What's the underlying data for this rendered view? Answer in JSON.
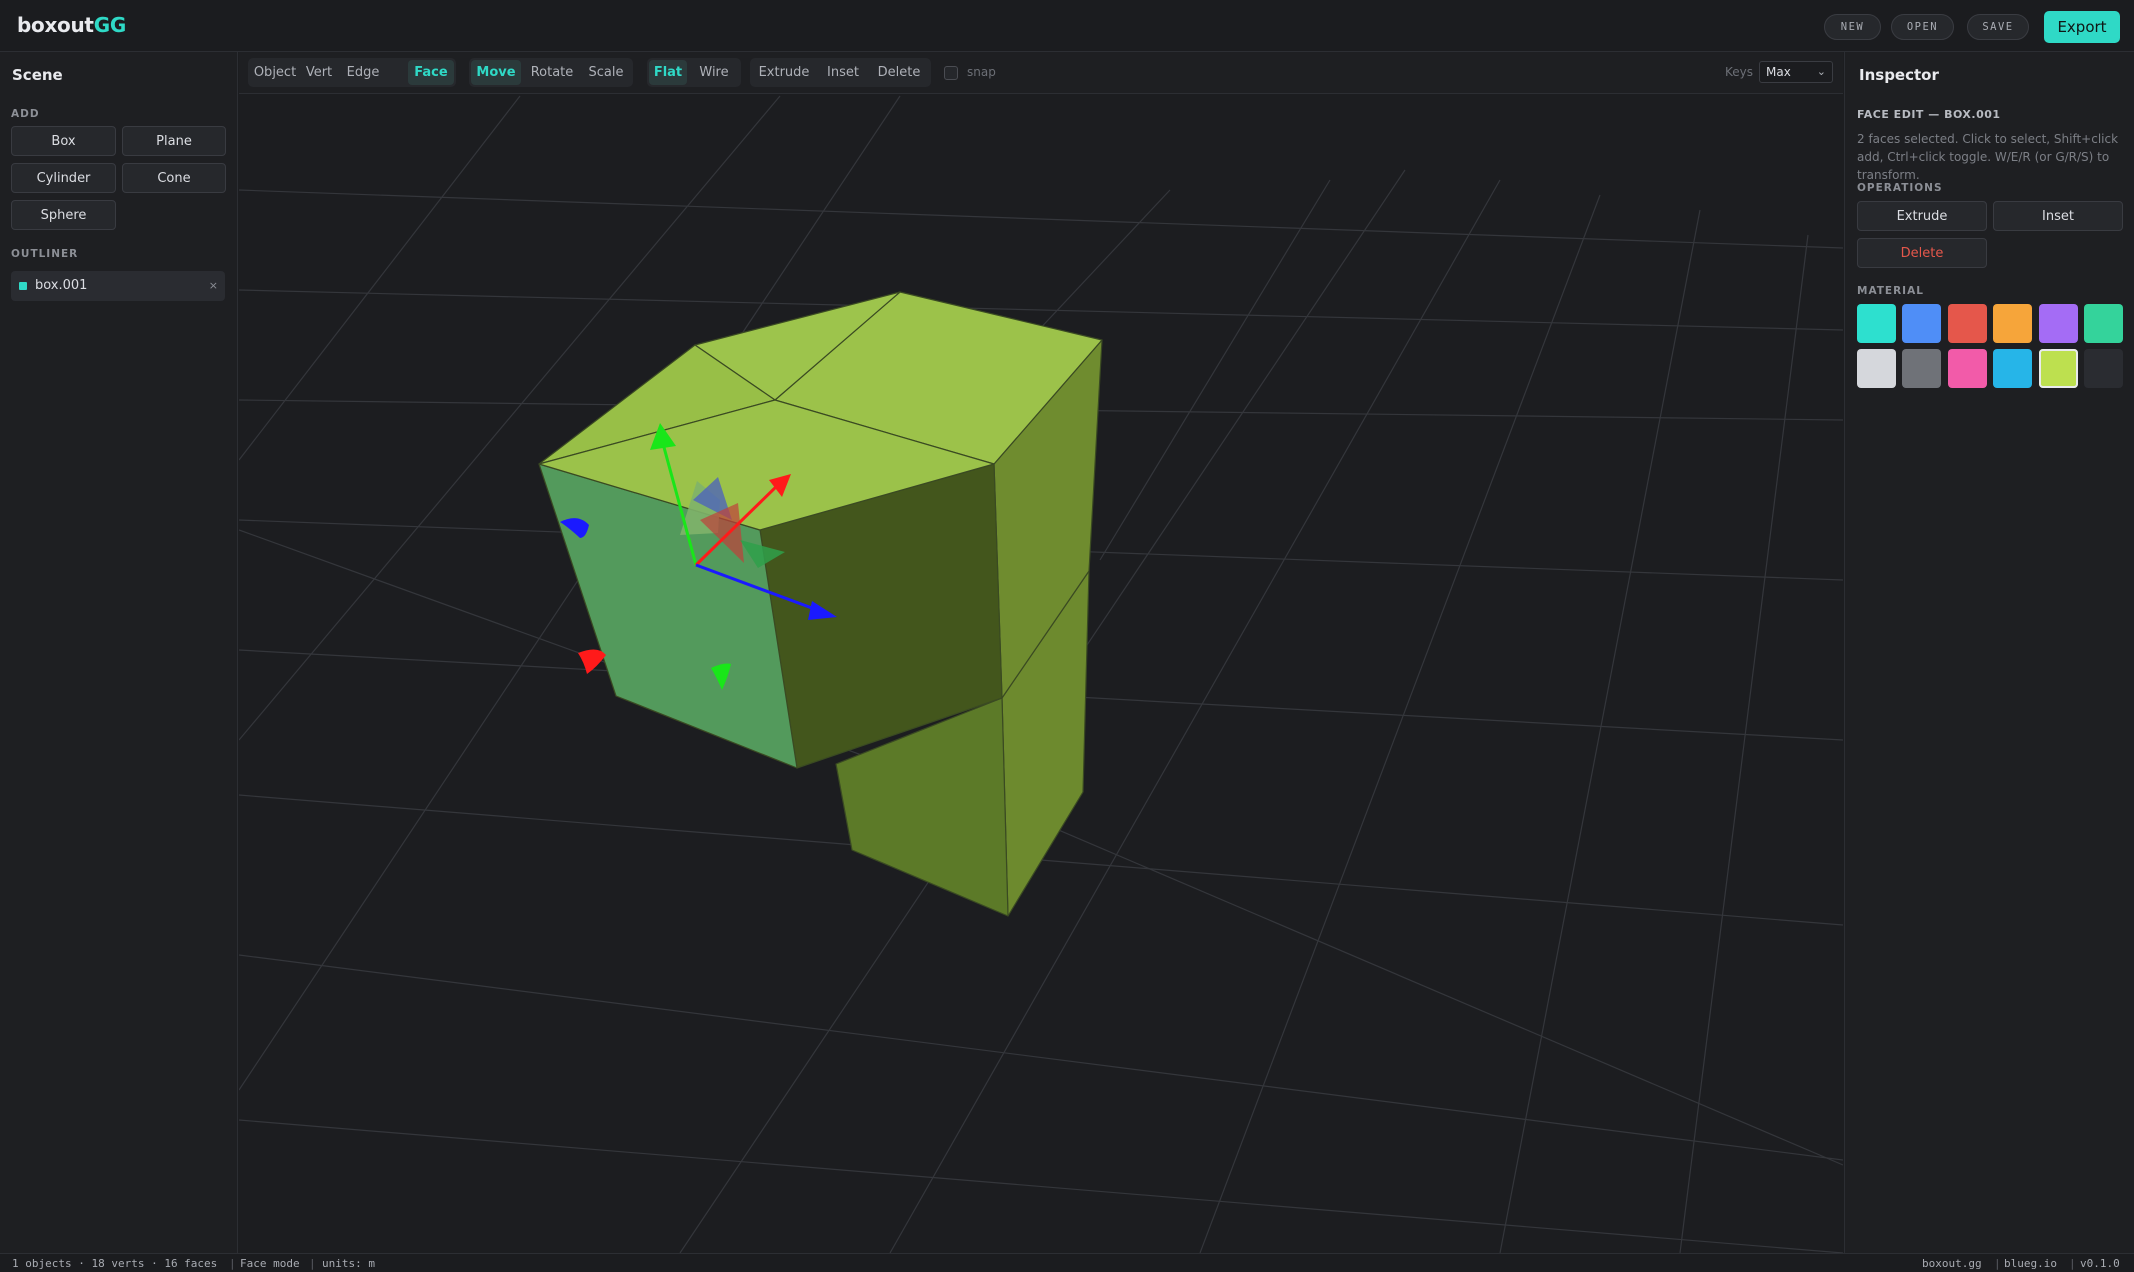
{
  "app": {
    "logo_first": "boxout",
    "logo_second": "GG"
  },
  "topbar": {
    "new_label": "NEW",
    "open_label": "OPEN",
    "save_label": "SAVE",
    "export_label": "Export"
  },
  "scene_panel": {
    "title": "Scene",
    "add_label": "ADD",
    "add_buttons": [
      "Box",
      "Plane",
      "Cylinder",
      "Cone",
      "Sphere"
    ],
    "outliner_label": "OUTLINER",
    "outliner_items": [
      {
        "name": "box.001",
        "remove": "×"
      }
    ]
  },
  "viewport_toolbar": {
    "select_modes": [
      "Object",
      "Vert",
      "Edge",
      "Face"
    ],
    "active_select_mode": "Face",
    "transform_modes": [
      "Move",
      "Rotate",
      "Scale"
    ],
    "active_transform_mode": "Move",
    "shading_modes": [
      "Flat",
      "Wire"
    ],
    "active_shading_mode": "Flat",
    "operations": [
      "Extrude",
      "Inset",
      "Delete"
    ],
    "snap_label": "snap",
    "snap_checked": false,
    "keys_label": "Keys",
    "keys_value": "Max"
  },
  "inspector": {
    "title": "Inspector",
    "subtitle": "FACE EDIT — BOX.001",
    "help": "2 faces selected. Click to select, Shift+click add, Ctrl+click toggle. W/E/R (or G/R/S) to transform.",
    "operations_label": "OPERATIONS",
    "extrude_label": "Extrude",
    "inset_label": "Inset",
    "delete_label": "Delete",
    "material_label": "MATERIAL",
    "swatches": [
      "#2de0cf",
      "#4f8ef7",
      "#e5574b",
      "#f6a53a",
      "#a46cf5",
      "#34d39b",
      "#d5d7dc",
      "#6f7278",
      "#f25ba9",
      "#26b5e8",
      "#bde04f",
      "#2a2c31"
    ],
    "selected_swatch": 10
  },
  "statusbar": {
    "objects": "1 objects · 18 verts · 16 faces",
    "mode": "Face mode",
    "units": "units: m",
    "right": [
      "boxout.gg",
      "blueg.io",
      "v0.1.0"
    ]
  },
  "colors": {
    "accent": "#2fd9c6",
    "danger": "#e5574b",
    "gizmo_x": "#ff1a1a",
    "gizmo_y": "#19e619",
    "gizmo_z": "#1a1aff"
  }
}
